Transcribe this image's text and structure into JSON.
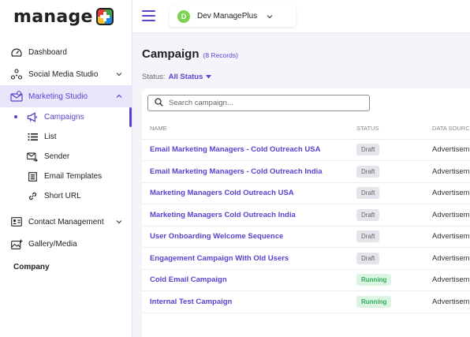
{
  "brand": {
    "name": "manage"
  },
  "sidebar": {
    "items": [
      {
        "label": "Dashboard",
        "icon": "dashboard-icon"
      },
      {
        "label": "Social Media Studio",
        "icon": "social-network-icon"
      },
      {
        "label": "Marketing Studio",
        "icon": "marketing-icon"
      },
      {
        "label": "Contact Management",
        "icon": "contact-card-icon"
      },
      {
        "label": "Gallery/Media",
        "icon": "gallery-icon"
      }
    ],
    "marketing_sub": [
      {
        "label": "Campaigns",
        "icon": "megaphone-icon"
      },
      {
        "label": "List",
        "icon": "list-icon"
      },
      {
        "label": "Sender",
        "icon": "sender-icon"
      },
      {
        "label": "Email Templates",
        "icon": "template-icon"
      },
      {
        "label": "Short URL",
        "icon": "link-icon"
      }
    ],
    "company_label": "Company"
  },
  "header": {
    "workspace_initial": "D",
    "workspace_name": "Dev ManagePlus"
  },
  "main": {
    "title": "Campaign",
    "record_count": "(8 Records)",
    "status_label": "Status:",
    "status_value": "All Status",
    "search_placeholder": "Search campaign...",
    "columns": [
      "NAME",
      "STATUS",
      "DATA SOURC"
    ],
    "rows": [
      {
        "name": "Email Marketing Managers - Cold Outreach USA",
        "status": "Draft",
        "source": "Advertisem"
      },
      {
        "name": "Email Marketing Managers - Cold Outreach India",
        "status": "Draft",
        "source": "Advertisem"
      },
      {
        "name": "Marketing Managers Cold Outreach USA",
        "status": "Draft",
        "source": "Advertisem"
      },
      {
        "name": "Marketing Managers Cold Outreach India",
        "status": "Draft",
        "source": "Advertisem"
      },
      {
        "name": "User Onboarding Welcome Sequence",
        "status": "Draft",
        "source": "Advertisem"
      },
      {
        "name": "Engagement Campaign With Old Users",
        "status": "Draft",
        "source": "Advertisem"
      },
      {
        "name": "Cold Email Campaign",
        "status": "Running",
        "source": "Advertisem"
      },
      {
        "name": "Internal Test Campaign",
        "status": "Running",
        "source": "Advertisem"
      }
    ]
  },
  "colors": {
    "accent": "#5b3fd1",
    "active_bg": "#e9e6fb",
    "running": "#2eac57",
    "avatar": "#7bd34f"
  }
}
